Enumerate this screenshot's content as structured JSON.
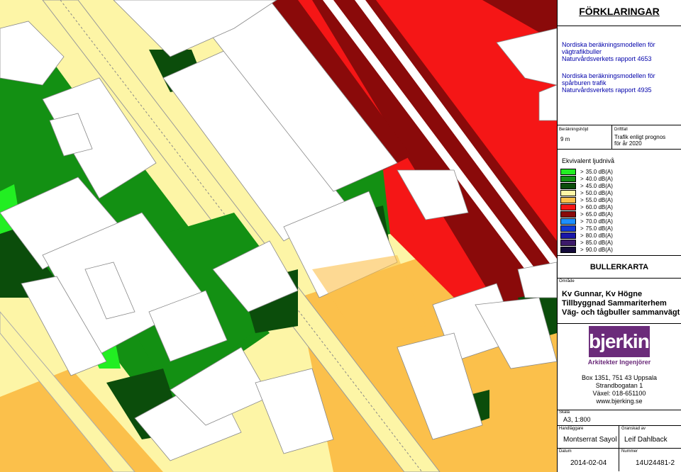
{
  "legend": {
    "heading": "FÖRKLARINGAR",
    "models": [
      {
        "lines": [
          "Nordiska beräkningsmodellen för",
          "vägtrafikbuller",
          "Naturvårdsverkets rapport 4653"
        ]
      },
      {
        "lines": [
          "Nordiska beräkningsmodellen för",
          "spårburen trafik",
          "Naturvårdsverkets rapport 4935"
        ]
      }
    ],
    "calc_height_label": "Beräkningshöjd",
    "calc_height_value": "9 m",
    "case_label": "Driftfall",
    "case_value_line1": "Trafik enligt prognos",
    "case_value_line2": "för år 2020",
    "levels_title": "Ekvivalent ljudnivå",
    "levels": [
      {
        "label": "35.0 dB(A)",
        "color": "#22ee22"
      },
      {
        "label": "40.0 dB(A)",
        "color": "#139013"
      },
      {
        "label": "45.0 dB(A)",
        "color": "#0b4d0b"
      },
      {
        "label": "50.0 dB(A)",
        "color": "#fdf5a6"
      },
      {
        "label": "55.0 dB(A)",
        "color": "#fbc04b"
      },
      {
        "label": "60.0 dB(A)",
        "color": "#f51616"
      },
      {
        "label": "65.0 dB(A)",
        "color": "#8a0a0a"
      },
      {
        "label": "70.0 dB(A)",
        "color": "#1e90ff"
      },
      {
        "label": "75.0 dB(A)",
        "color": "#1238d8"
      },
      {
        "label": "80.0 dB(A)",
        "color": "#1a17a8"
      },
      {
        "label": "85.0 dB(A)",
        "color": "#3c1a6a"
      },
      {
        "label": "90.0 dB(A)",
        "color": "#140a3a"
      }
    ],
    "gt": ">",
    "map_type": "BULLERKARTA",
    "area_label": "Område",
    "area_lines": [
      "Kv Gunnar, Kv Högne",
      "Tillbyggnad Sammariterhem",
      "Väg- och tågbuller sammanvägt"
    ],
    "company_logo": "bjerking",
    "company_sub": "Arkitekter Ingenjörer",
    "address_lines": [
      "Box 1351, 751 43 Uppsala",
      "Strandbogatan 1",
      "Växel: 018-651100",
      "www.bjerking.se"
    ],
    "scale_label": "Skala",
    "scale_value": "A3, 1:800",
    "handler_label": "Handläggare",
    "handler_value": "Montserrat Sayol",
    "reviewer_label": "Granskad av",
    "reviewer_value": "Leif Dahlback",
    "date_label": "Datum",
    "date_value": "2014-02-04",
    "number_label": "Nummer",
    "number_value": "14U24481-2",
    "brand_color": "#6b2b7a"
  }
}
